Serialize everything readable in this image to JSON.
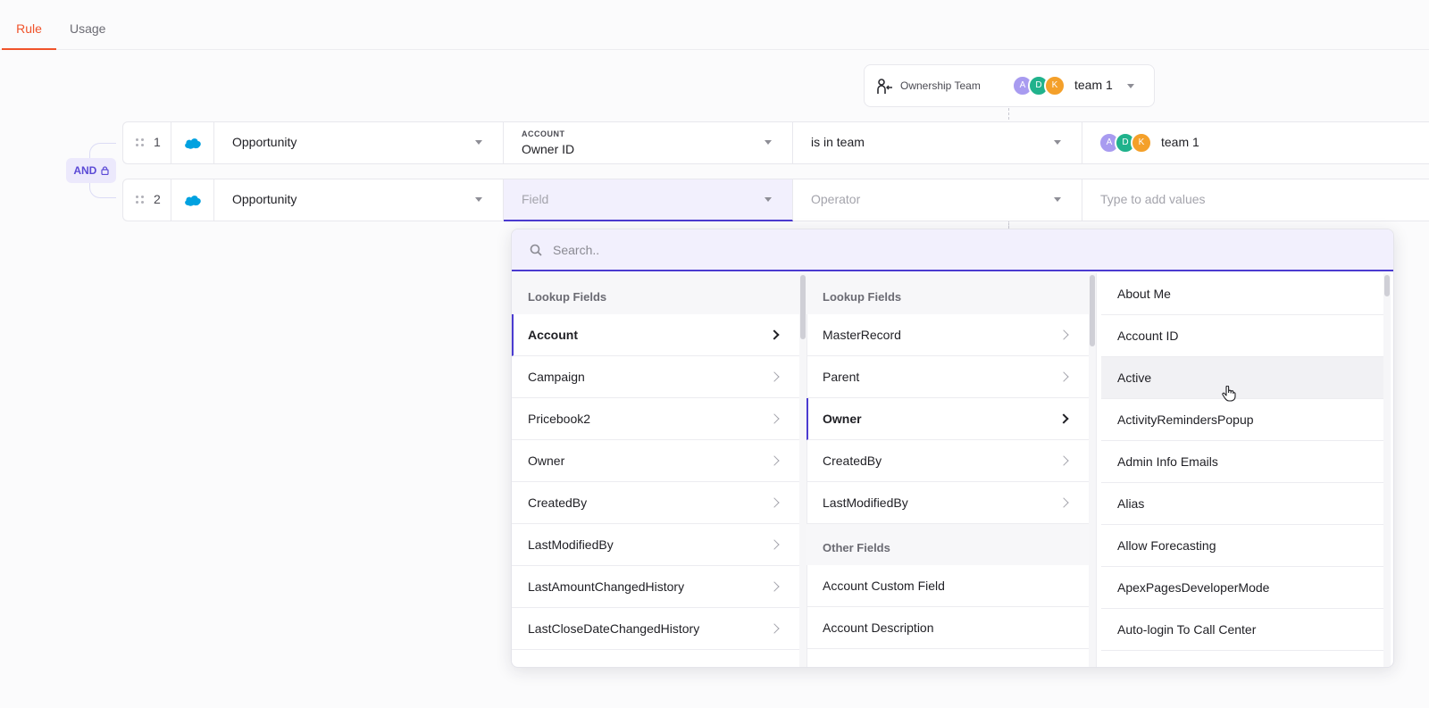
{
  "tabs": [
    {
      "label": "Rule",
      "active": true
    },
    {
      "label": "Usage",
      "active": false
    }
  ],
  "ownership": {
    "label": "Ownership Team",
    "avatars": [
      "A",
      "D",
      "K"
    ],
    "team": "team 1"
  },
  "connector": {
    "label": "AND"
  },
  "rows": [
    {
      "number": "1",
      "object": "Opportunity",
      "field_group": "ACCOUNT",
      "field": "Owner ID",
      "operator": "is in team",
      "value_avatars": [
        "A",
        "D",
        "K"
      ],
      "value": "team 1"
    },
    {
      "number": "2",
      "object": "Opportunity",
      "field_placeholder": "Field",
      "operator_placeholder": "Operator",
      "value_placeholder": "Type to add values"
    }
  ],
  "dropdown": {
    "search_placeholder": "Search..",
    "col1": {
      "header": "Lookup Fields",
      "items": [
        "Account",
        "Campaign",
        "Pricebook2",
        "Owner",
        "CreatedBy",
        "LastModifiedBy",
        "LastAmountChangedHistory",
        "LastCloseDateChangedHistory"
      ],
      "selected": "Account"
    },
    "col2": {
      "header": "Lookup Fields",
      "items": [
        "MasterRecord",
        "Parent",
        "Owner",
        "CreatedBy",
        "LastModifiedBy"
      ],
      "selected": "Owner",
      "header2": "Other Fields",
      "items2": [
        "Account Custom Field",
        "Account Description"
      ]
    },
    "col3": {
      "items": [
        "About Me",
        "Account ID",
        "Active",
        "ActivityRemindersPopup",
        "Admin Info Emails",
        "Alias",
        "Allow Forecasting",
        "ApexPagesDeveloperMode",
        "Auto-login To Call Center"
      ],
      "hovered": "Active"
    }
  },
  "colors": {
    "accent": "#4b3bd0",
    "tab_active": "#f0532b",
    "salesforce": "#00a1e0"
  }
}
